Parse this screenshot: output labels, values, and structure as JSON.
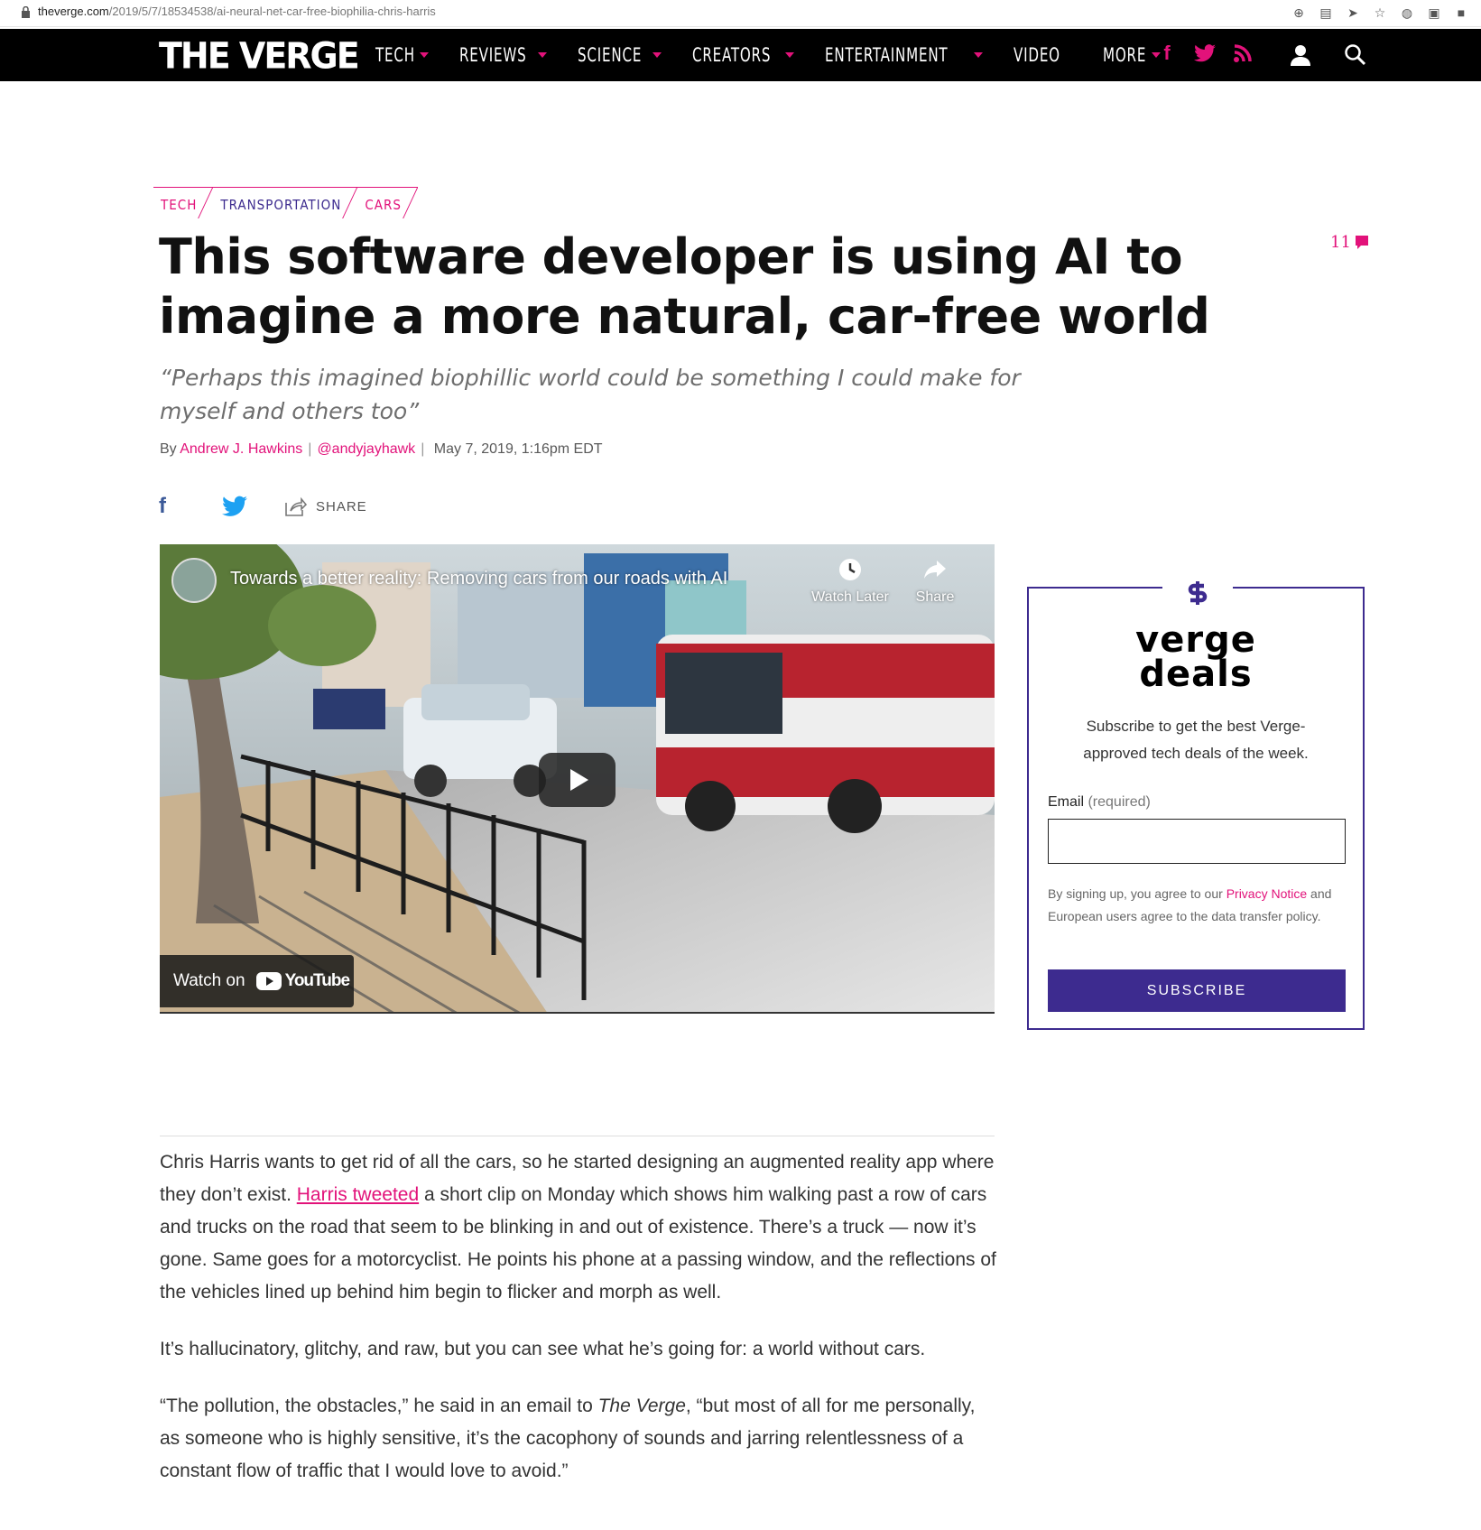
{
  "browser": {
    "url_host": "theverge.com",
    "url_path": "/2019/5/7/18534538/ai-neural-net-car-free-biophilia-chris-harris"
  },
  "nav": {
    "logo": "THE VERGE",
    "items": [
      {
        "label": "TECH",
        "dropdown": true
      },
      {
        "label": "REVIEWS",
        "dropdown": true
      },
      {
        "label": "SCIENCE",
        "dropdown": true
      },
      {
        "label": "CREATORS",
        "dropdown": true
      },
      {
        "label": "ENTERTAINMENT",
        "dropdown": true
      },
      {
        "label": "VIDEO",
        "dropdown": false
      },
      {
        "label": "MORE",
        "dropdown": true
      }
    ],
    "social_icons": [
      "facebook-icon",
      "twitter-icon",
      "rss-icon"
    ],
    "accent": "#e2127a"
  },
  "article": {
    "tags": [
      "TECH",
      "TRANSPORTATION",
      "CARS"
    ],
    "comment_count": "11",
    "title": "This software developer is using AI to imagine a more natural, car-free world",
    "dek": "“Perhaps this imagined biophillic world could be something I could make for myself and others too”",
    "byline": {
      "prefix": "By",
      "author": "Andrew J. Hawkins",
      "handle": "@andyjayhawk",
      "date": "May 7, 2019, 1:16pm EDT"
    },
    "share_label": "SHARE",
    "video": {
      "title": "Towards a better reality: Removing cars from our roads with AI",
      "watch_later": "Watch Later",
      "share": "Share",
      "watch_on": "Watch on",
      "youtube": "YouTube"
    },
    "paragraphs": [
      {
        "before": "Chris Harris wants to get rid of all the cars, so he started designing an augmented reality app where they don’t exist. ",
        "link": "Harris tweeted",
        "after": " a short clip on Monday which shows him walking past a row of cars and trucks on the road that seem to be blinking in and out of existence. There’s a truck — now it’s gone. Same goes for a motorcyclist. He points his phone at a passing window, and the reflections of the vehicles lined up behind him begin to flicker and morph as well."
      },
      {
        "text": "It’s hallucinatory, glitchy, and raw, but you can see what he’s going for: a world without cars."
      },
      {
        "before": "“The pollution, the obstacles,” he said in an email to ",
        "em": "The Verge",
        "after": ", “but most of all for me personally, as someone who is highly sensitive, it’s the cacophony of sounds and jarring relentlessness of a constant flow of traffic that I would love to avoid.”"
      }
    ]
  },
  "deals": {
    "brand_line1": "verge",
    "brand_line2": "deals",
    "pitch": "Subscribe to get the best Verge-approved tech deals of the week.",
    "email_label": "Email",
    "email_required": "(required)",
    "email_value": "",
    "legal_before": "By signing up, you agree to our ",
    "legal_link": "Privacy Notice",
    "legal_after": " and European users agree to the data transfer policy.",
    "button": "SUBSCRIBE",
    "color": "#3d2b8f"
  }
}
